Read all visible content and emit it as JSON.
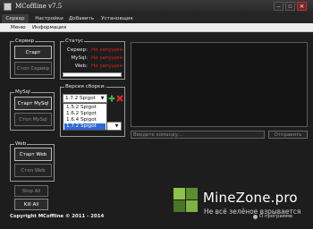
{
  "window": {
    "title": "MCoffline v7.5"
  },
  "tabs": [
    {
      "label": "Сервер"
    },
    {
      "label": "Настройки"
    },
    {
      "label": "Добавить"
    },
    {
      "label": "Установщик"
    }
  ],
  "menu": [
    {
      "label": "Меню"
    },
    {
      "label": "Информация"
    }
  ],
  "server_group": {
    "label": "Сервер",
    "start": "Старт",
    "stop": "Стоп Сервер"
  },
  "mysql_group": {
    "label": "MySql",
    "start": "Старт MySql",
    "stop": "Стоп MySql"
  },
  "web_group": {
    "label": "Web",
    "start": "Старт Web",
    "stop": "Стоп Web"
  },
  "actions": {
    "stop_all": "Stop All",
    "kill_all": "Kill All"
  },
  "status": {
    "label": "Статус",
    "rows": [
      {
        "key": "Сервер:",
        "value": "Не запущен"
      },
      {
        "key": "MySql:",
        "value": "Не запущен"
      },
      {
        "key": "Web:",
        "value": "Не запущен"
      }
    ],
    "value_color": "#e02020"
  },
  "build": {
    "label": "Версия сборки:",
    "selected": "1.7.2 Spigot",
    "options": [
      "1.5.2 Spigot",
      "1.6.2 Spigot",
      "1.6.4 Spigot",
      "1.7.2 Spigot"
    ],
    "add_icon": "plus-icon",
    "remove_icon": "close-icon"
  },
  "command": {
    "placeholder": "Введите команду...",
    "send": "Отправить"
  },
  "footer": {
    "copyright": "Copyright MCoffline © 2011 - 2014",
    "about": "О программе"
  },
  "watermark": {
    "title": "MineZone.pro",
    "subtitle": "Не всё зелёное взрывается"
  },
  "colors": {
    "accent_select": "#2f67d8",
    "logo_green": "#7cb342"
  }
}
